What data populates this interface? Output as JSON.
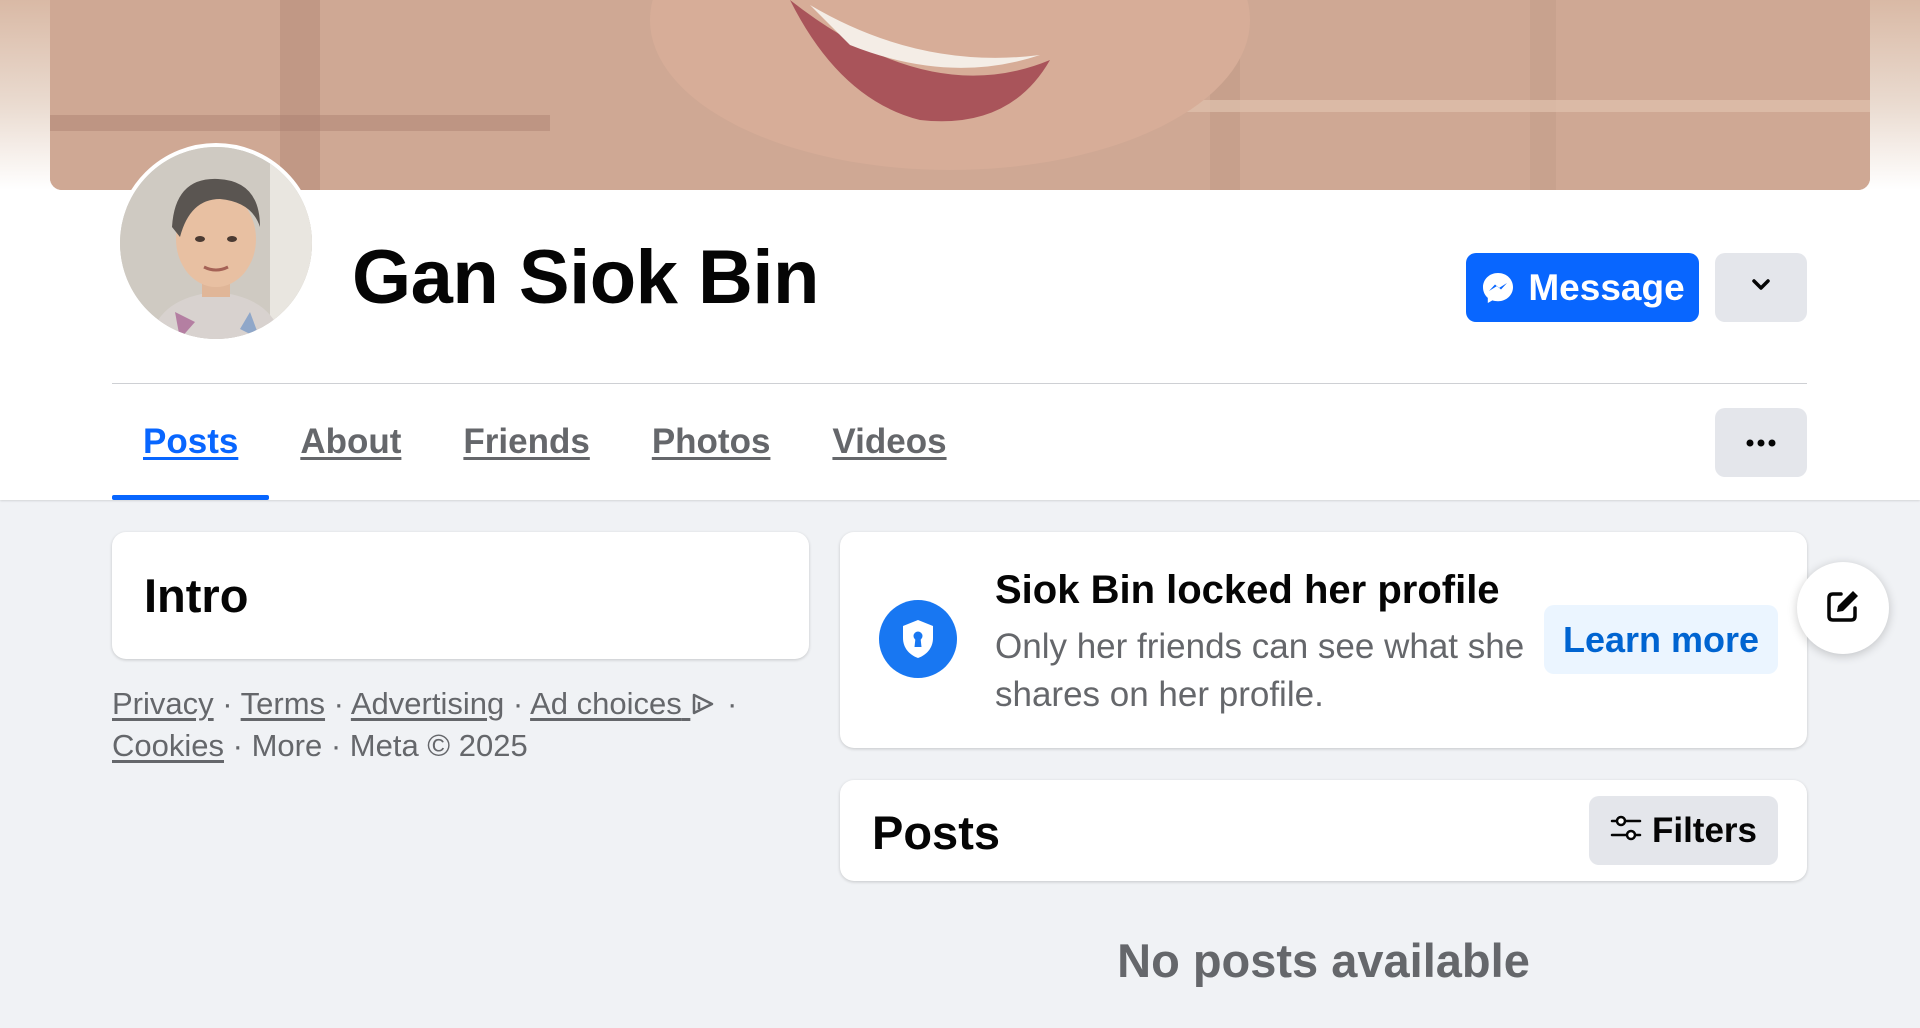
{
  "profile": {
    "name": "Gan Siok Bin",
    "message_label": "Message"
  },
  "tabs": [
    {
      "label": "Posts",
      "active": true
    },
    {
      "label": "About",
      "active": false
    },
    {
      "label": "Friends",
      "active": false
    },
    {
      "label": "Photos",
      "active": false
    },
    {
      "label": "Videos",
      "active": false
    }
  ],
  "intro": {
    "title": "Intro"
  },
  "footer": {
    "privacy": "Privacy",
    "terms": "Terms",
    "advertising": "Advertising",
    "ad_choices": "Ad choices",
    "cookies": "Cookies",
    "more": "More",
    "copyright": "Meta © 2025",
    "separator": " · "
  },
  "locked_notice": {
    "title": "Siok Bin locked her profile",
    "description": "Only her friends can see what she shares on her profile.",
    "learn_more_label": "Learn more"
  },
  "posts": {
    "title": "Posts",
    "filters_label": "Filters",
    "empty_message": "No posts available"
  },
  "icons": {
    "messenger": "messenger-icon",
    "dropdown": "chevron-down-icon",
    "more": "more-dots-icon",
    "shield": "shield-lock-icon",
    "filters": "filters-icon",
    "edit": "edit-icon",
    "ad_choices": "ad-choices-icon"
  },
  "colors": {
    "accent": "#0866ff",
    "background": "#f0f2f5",
    "secondary_text": "#65676b",
    "button_grey": "#e4e6eb"
  }
}
